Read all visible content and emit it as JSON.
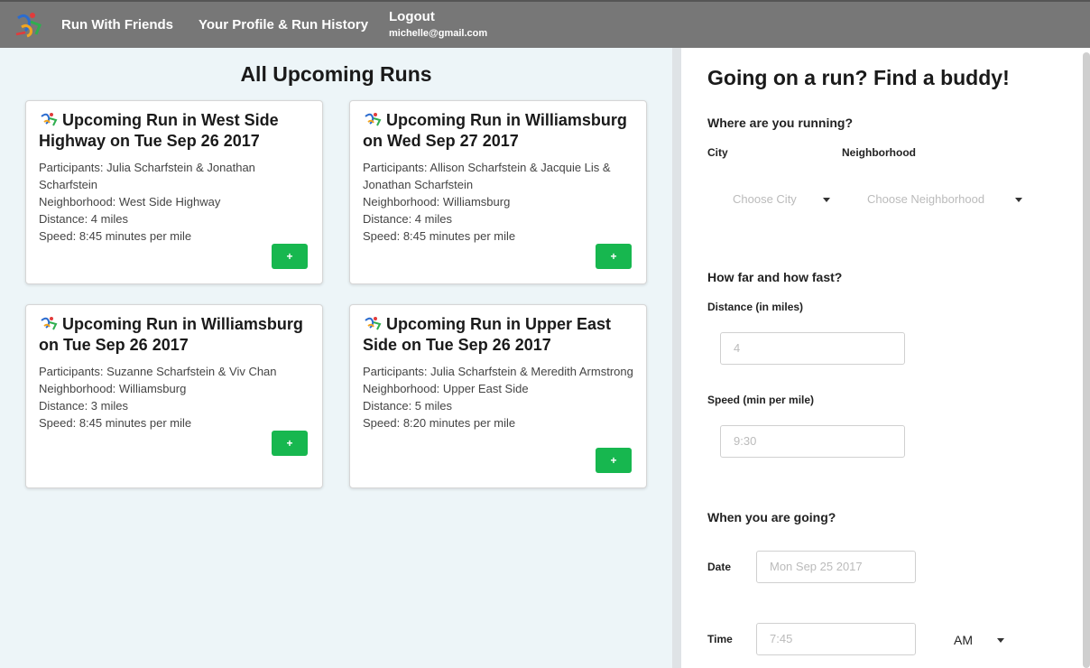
{
  "nav": {
    "brand": "Run With Friends",
    "profile": "Your Profile & Run History",
    "logout": "Logout",
    "email": "michelle@gmail.com"
  },
  "runs": {
    "title": "All Upcoming Runs",
    "add_label": "+",
    "cards": [
      {
        "title": "Upcoming Run in West Side Highway on Tue Sep 26 2017",
        "participants": "Participants: Julia Scharfstein & Jonathan Scharfstein",
        "neighborhood": "Neighborhood: West Side Highway",
        "distance": "Distance: 4 miles",
        "speed": "Speed: 8:45 minutes per mile"
      },
      {
        "title": "Upcoming Run in Williamsburg on Wed Sep 27 2017",
        "participants": "Participants: Allison Scharfstein & Jacquie Lis & Jonathan Scharfstein",
        "neighborhood": "Neighborhood: Williamsburg",
        "distance": "Distance: 4 miles",
        "speed": "Speed: 8:45 minutes per mile"
      },
      {
        "title": "Upcoming Run in Williamsburg on Tue Sep 26 2017",
        "participants": "Participants: Suzanne Scharfstein & Viv Chan",
        "neighborhood": "Neighborhood: Williamsburg",
        "distance": "Distance: 3 miles",
        "speed": "Speed: 8:45 minutes per mile"
      },
      {
        "title": "Upcoming Run in Upper East Side on Tue Sep 26 2017",
        "participants": "Participants: Julia Scharfstein & Meredith Armstrong",
        "neighborhood": "Neighborhood: Upper East Side",
        "distance": "Distance: 5 miles",
        "speed": "Speed: 8:20 minutes per mile"
      }
    ]
  },
  "form": {
    "title": "Going on a run? Find a buddy!",
    "where_heading": "Where are you running?",
    "city_label": "City",
    "neighborhood_label": "Neighborhood",
    "city_placeholder": "Choose City",
    "neighborhood_placeholder": "Choose Neighborhood",
    "how_heading": "How far and how fast?",
    "distance_label": "Distance (in miles)",
    "distance_placeholder": "4",
    "speed_label": "Speed (min per mile)",
    "speed_placeholder": "9:30",
    "when_heading": "When you are going?",
    "date_label": "Date",
    "date_placeholder": "Mon Sep 25 2017",
    "time_label": "Time",
    "time_placeholder": "7:45",
    "ampm_value": "AM"
  },
  "colors": {
    "navbar": "#777777",
    "accent_green": "#17b74f",
    "left_panel_bg": "#edf5f8"
  },
  "icons": {
    "logo": "runner-logo-icon",
    "dropdown": "caret-down-icon"
  }
}
